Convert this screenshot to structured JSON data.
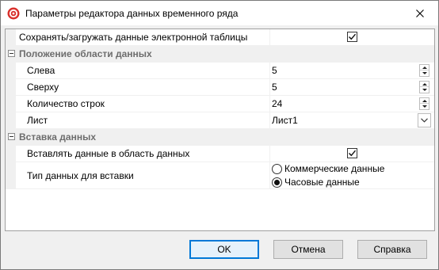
{
  "window": {
    "title": "Параметры редактора данных временного ряда"
  },
  "properties": {
    "save_load_label": "Сохранять/загружать данные электронной таблицы",
    "save_load_checked": true,
    "area_category": "Положение области данных",
    "left_label": "Слева",
    "left_value": "5",
    "top_label": "Сверху",
    "top_value": "5",
    "rows_label": "Количество строк",
    "rows_value": "24",
    "sheet_label": "Лист",
    "sheet_value": "Лист1",
    "insert_category": "Вставка данных",
    "insert_into_area_label": "Вставлять данные в область данных",
    "insert_into_area_checked": true,
    "data_type_label": "Тип данных для вставки",
    "data_type_options": [
      "Коммерческие данные",
      "Часовые данные"
    ],
    "data_type_selected": "Часовые данные"
  },
  "buttons": {
    "ok": "OK",
    "cancel": "Отмена",
    "help": "Справка"
  },
  "colors": {
    "accent": "#0078d7",
    "category_text": "#6d6d6d",
    "app_icon": "#d9302c"
  }
}
